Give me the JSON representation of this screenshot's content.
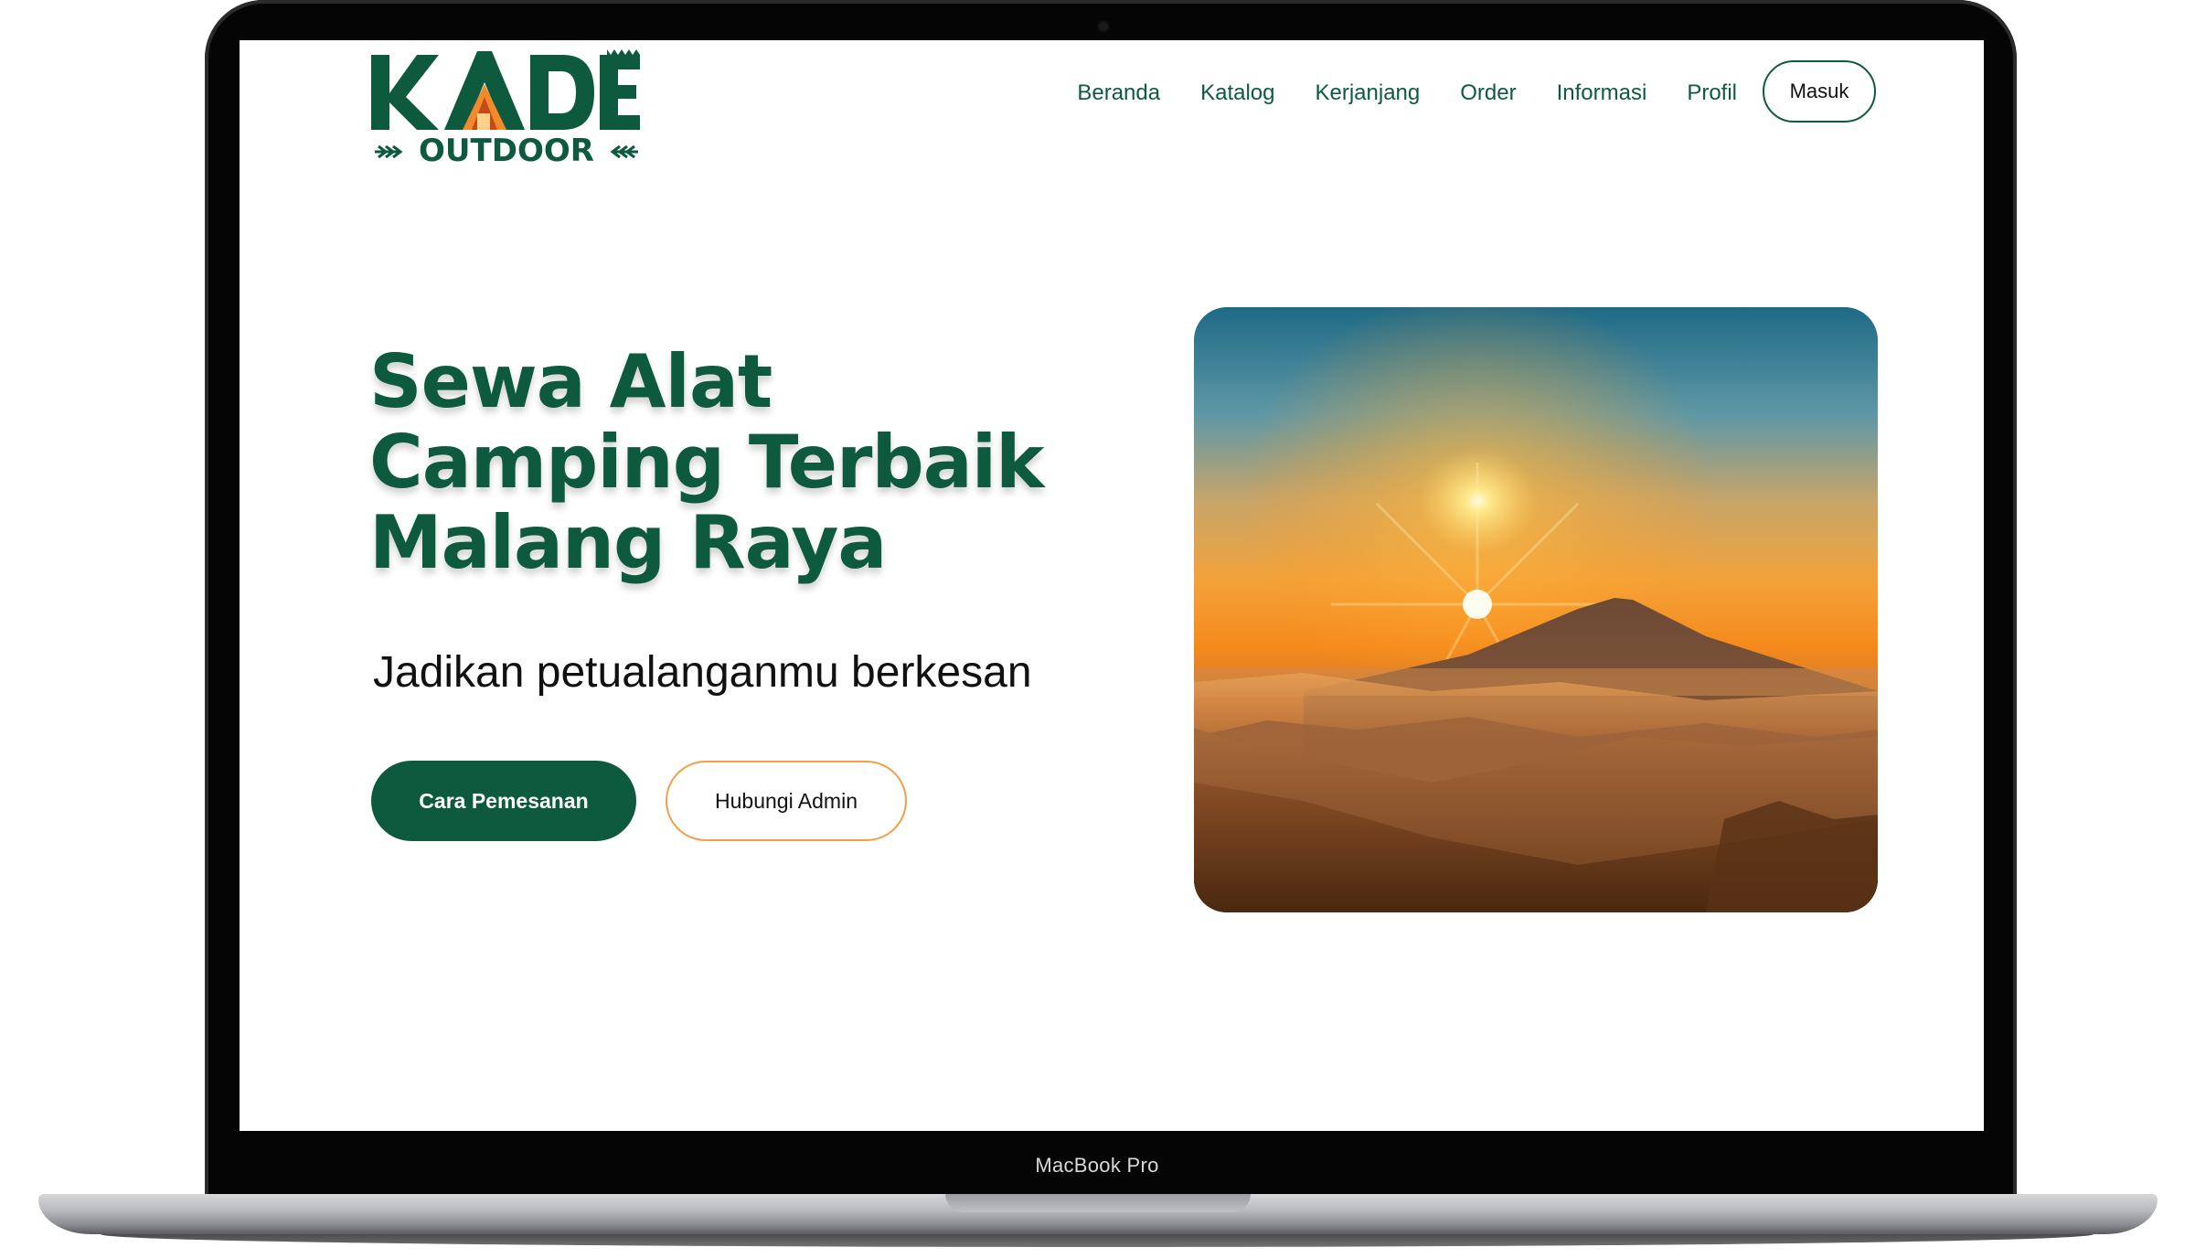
{
  "device": {
    "model_label": "MacBook Pro"
  },
  "site": {
    "logo": {
      "wordmark": "KADE",
      "sub": "OUTDOOR"
    },
    "nav": {
      "links": [
        "Beranda",
        "Katalog",
        "Kerjanjang",
        "Order",
        "Informasi",
        "Profil"
      ],
      "login_label": "Masuk"
    },
    "hero": {
      "title": "Sewa Alat Camping Terbaik Malang Raya",
      "subtitle": "Jadikan petualanganmu berkesan",
      "primary_button": "Cara Pemesanan",
      "secondary_button": "Hubungi Admin",
      "image_icon": "mountain-sunrise-photo"
    }
  },
  "colors": {
    "brand_green": "#0e5a3f",
    "accent_orange": "#f0a04a",
    "frame_black": "#050505"
  }
}
